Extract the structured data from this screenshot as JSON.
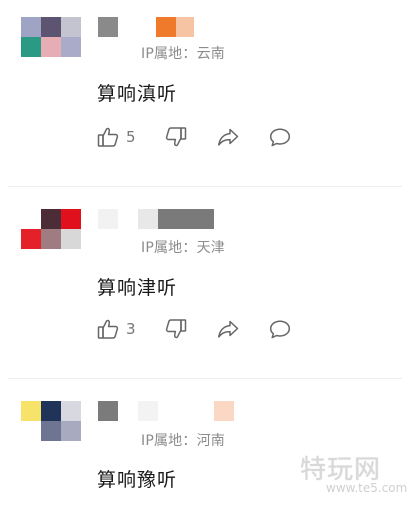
{
  "comments": [
    {
      "avatar_colors": [
        "#9fa3c4",
        "#5c5470",
        "#c4c4d0",
        "#2a9a84",
        "#e7adb4",
        "#a9abc8"
      ],
      "username_colors": [
        "#8a8a8a",
        "#f07a2c",
        "#f6c4a2"
      ],
      "ip_location": "IP属地：云南",
      "text": "算响滇听",
      "like_count": "5"
    },
    {
      "avatar_colors": [
        "#ffffff",
        "#4b2c37",
        "#e0101c",
        "#e42029",
        "#9e7c82",
        "#d8d8d8"
      ],
      "username_colors": [
        "#f2f2f2",
        "#e8e8e8",
        "#7a7a7a"
      ],
      "ip_location": "IP属地：天津",
      "text": "算响津听",
      "like_count": "3"
    },
    {
      "avatar_colors": [
        "#f7e36a",
        "#20345a",
        "#d8d8e0",
        "#ffffff",
        "#6d7592",
        "#a8abc0"
      ],
      "username_colors": [
        "#7b7b7b",
        "#f3f3f3",
        "#fbd8c4"
      ],
      "ip_location": "IP属地：河南",
      "text": "算响豫听",
      "like_count": ""
    }
  ],
  "icons": {
    "like": "thumbs-up-icon",
    "dislike": "thumbs-down-icon",
    "share": "share-arrow-icon",
    "reply": "comment-bubble-icon"
  },
  "watermark": {
    "main": "特玩网",
    "sub": "www.te5.com"
  }
}
